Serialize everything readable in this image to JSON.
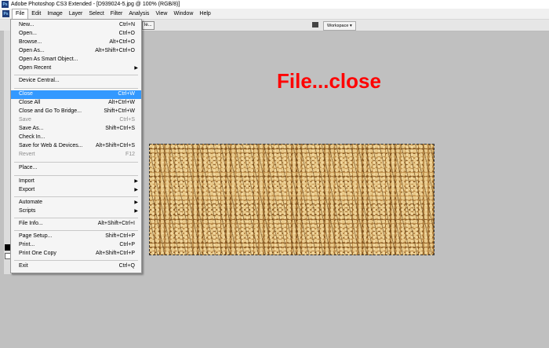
{
  "window": {
    "title": "Adobe Photoshop CS3 Extended - [D939024-5.jpg @ 100% (RGB/8)]",
    "logo_text": "Ps"
  },
  "menubar": {
    "items": [
      "File",
      "Edit",
      "Image",
      "Layer",
      "Select",
      "Filter",
      "Analysis",
      "View",
      "Window",
      "Help"
    ]
  },
  "options_bar": {
    "workspace_label": "Workspace",
    "partial_button": "le..."
  },
  "annotation": {
    "text": "File...close",
    "color": "#ff0000"
  },
  "file_menu": {
    "items": [
      {
        "label": "New...",
        "shortcut": "Ctrl+N"
      },
      {
        "label": "Open...",
        "shortcut": "Ctrl+O"
      },
      {
        "label": "Browse...",
        "shortcut": "Alt+Ctrl+O"
      },
      {
        "label": "Open As...",
        "shortcut": "Alt+Shift+Ctrl+O"
      },
      {
        "label": "Open As Smart Object...",
        "shortcut": ""
      },
      {
        "label": "Open Recent",
        "shortcut": "",
        "submenu": true
      },
      {
        "label": "Device Central...",
        "shortcut": ""
      },
      {
        "label": "Close",
        "shortcut": "Ctrl+W",
        "highlighted": true
      },
      {
        "label": "Close All",
        "shortcut": "Alt+Ctrl+W"
      },
      {
        "label": "Close and Go To Bridge...",
        "shortcut": "Shift+Ctrl+W"
      },
      {
        "label": "Save",
        "shortcut": "Ctrl+S",
        "disabled": true
      },
      {
        "label": "Save As...",
        "shortcut": "Shift+Ctrl+S"
      },
      {
        "label": "Check In...",
        "shortcut": ""
      },
      {
        "label": "Save for Web & Devices...",
        "shortcut": "Alt+Shift+Ctrl+S"
      },
      {
        "label": "Revert",
        "shortcut": "F12",
        "disabled": true
      },
      {
        "label": "Place...",
        "shortcut": ""
      },
      {
        "label": "Import",
        "shortcut": "",
        "submenu": true
      },
      {
        "label": "Export",
        "shortcut": "",
        "submenu": true
      },
      {
        "label": "Automate",
        "shortcut": "",
        "submenu": true
      },
      {
        "label": "Scripts",
        "shortcut": "",
        "submenu": true
      },
      {
        "label": "File Info...",
        "shortcut": "Alt+Shift+Ctrl+I"
      },
      {
        "label": "Page Setup...",
        "shortcut": "Shift+Ctrl+P"
      },
      {
        "label": "Print...",
        "shortcut": "Ctrl+P"
      },
      {
        "label": "Print One Copy",
        "shortcut": "Alt+Shift+Ctrl+P"
      },
      {
        "label": "Exit",
        "shortcut": "Ctrl+Q"
      }
    ]
  },
  "colors": {
    "highlight": "#3399ff",
    "workspace_bg": "#c0c0c0"
  }
}
